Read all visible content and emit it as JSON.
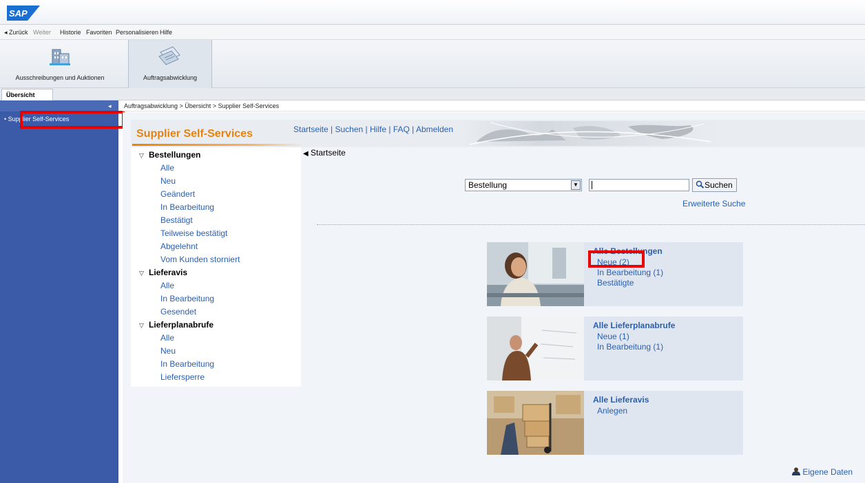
{
  "brand": {
    "logo_text": "SAP"
  },
  "menubar": {
    "back": "◂ Zurück",
    "forward": "Weiter",
    "history": "Historie",
    "favorites": "Favoriten",
    "personalize": "Personalisieren",
    "help": "Hilfe"
  },
  "workareas": [
    {
      "label": "Ausschreibungen und Auktionen",
      "icon": "building-icon"
    },
    {
      "label": "Auftragsabwicklung",
      "icon": "documents-icon",
      "active": true
    }
  ],
  "subtab": {
    "label": "Übersicht"
  },
  "leftnav": {
    "item": "• Supplier Self-Services",
    "collapse_icon": "◂"
  },
  "breadcrumb": "Auftragsabwicklung  >  Übersicht  >  Supplier Self-Services",
  "sss": {
    "title": "Supplier Self-Services",
    "links": {
      "startseite": "Startseite",
      "suchen": "Suchen",
      "hilfe": "Hilfe",
      "faq": "FAQ",
      "abmelden": "Abmelden",
      "separator": " | "
    }
  },
  "tree": {
    "groups": [
      {
        "label": "Bestellungen",
        "items": [
          "Alle",
          "Neu",
          "Geändert",
          "In Bearbeitung",
          "Bestätigt",
          "Teilweise bestätigt",
          "Abgelehnt",
          "Vom Kunden storniert"
        ]
      },
      {
        "label": "Lieferavis",
        "items": [
          "Alle",
          "In Bearbeitung",
          "Gesendet"
        ]
      },
      {
        "label": "Lieferplanabrufe",
        "items": [
          "Alle",
          "Neu",
          "In Bearbeitung",
          "Liefersperre"
        ]
      }
    ]
  },
  "content": {
    "startseite": "Startseite",
    "search": {
      "selected": "Bestellung",
      "input_value": "",
      "button": "Suchen",
      "advanced": "Erweiterte Suche"
    },
    "cards": [
      {
        "title": "Alle Bestellungen",
        "links": [
          "Neue (2)",
          "In Bearbeitung (1)",
          "Bestätigte"
        ]
      },
      {
        "title": "Alle Lieferplanabrufe",
        "links": [
          "Neue (1)",
          "In Bearbeitung (1)"
        ]
      },
      {
        "title": "Alle Lieferavis",
        "links": [
          "Anlegen"
        ]
      }
    ]
  },
  "footer": {
    "own_data": "Eigene Daten"
  },
  "colors": {
    "accent_orange": "#e8820c",
    "link_blue": "#2a5fb0",
    "nav_blue": "#3b5ba8",
    "highlight_red": "#e60000"
  }
}
